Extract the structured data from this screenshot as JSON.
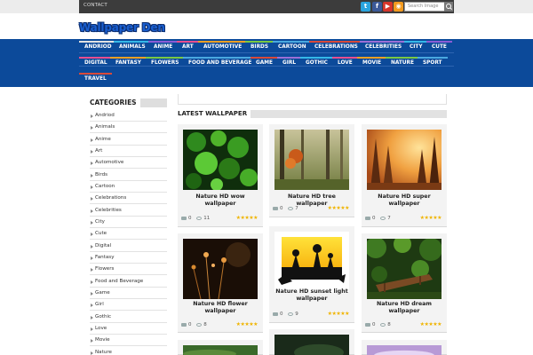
{
  "topbar": {
    "contact": "CONTACT",
    "search_placeholder": "Search Image",
    "social_icons": [
      "twitter-icon",
      "facebook-icon",
      "youtube-icon",
      "rss-icon"
    ]
  },
  "logo": {
    "text": "Wallpaper Den"
  },
  "nav": {
    "items": [
      "ANDRIOD",
      "ANIMALS",
      "ANIME",
      "ART",
      "AUTOMOTIVE",
      "BIRDS",
      "CARTOON",
      "CELEBRATIONS",
      "CELEBRITIES",
      "CITY",
      "CUTE",
      "DIGITAL",
      "FANTASY",
      "FLOWERS",
      "FOOD AND BEVERAGE",
      "GAME",
      "GIRL",
      "GOTHIC",
      "LOVE",
      "MOVIE",
      "NATURE",
      "SPORT",
      "TRAVEL"
    ],
    "accent_colors": [
      "#e2e2e2",
      "#35b8e8",
      "#8b5cd6",
      "#e94e8f",
      "#f4a024",
      "#7ac943",
      "#4aa9e0",
      "#d94a3a",
      "#9c6fd6"
    ]
  },
  "sidebar": {
    "title": "CATEGORIES",
    "items": [
      "Andriod",
      "Animals",
      "Anime",
      "Art",
      "Automotive",
      "Birds",
      "Cartoon",
      "Celebrations",
      "Celebrities",
      "City",
      "Cute",
      "Digital",
      "Fantasy",
      "Flowers",
      "Food and Beverage",
      "Game",
      "Girl",
      "Gothic",
      "Love",
      "Movie",
      "Nature"
    ]
  },
  "main": {
    "title": "LATEST WALLPAPER",
    "cards": [
      {
        "title": "Nature HD wow wallpaper",
        "comments": "0",
        "views": "11",
        "rating": "★★★★★"
      },
      {
        "title": "Nature HD tree wallpaper",
        "comments": "0",
        "views": "7",
        "rating": "★★★★★"
      },
      {
        "title": "Nature HD super wallpaper",
        "comments": "0",
        "views": "7",
        "rating": "★★★★★"
      },
      {
        "title": "Nature HD flower wallpaper",
        "comments": "0",
        "views": "8",
        "rating": "★★★★★"
      },
      {
        "title": "Nature HD sunset light wallpaper",
        "comments": "0",
        "views": "9",
        "rating": "★★★★★"
      },
      {
        "title": "Nature HD dream wallpaper",
        "comments": "0",
        "views": "8",
        "rating": "★★★★★"
      }
    ]
  }
}
